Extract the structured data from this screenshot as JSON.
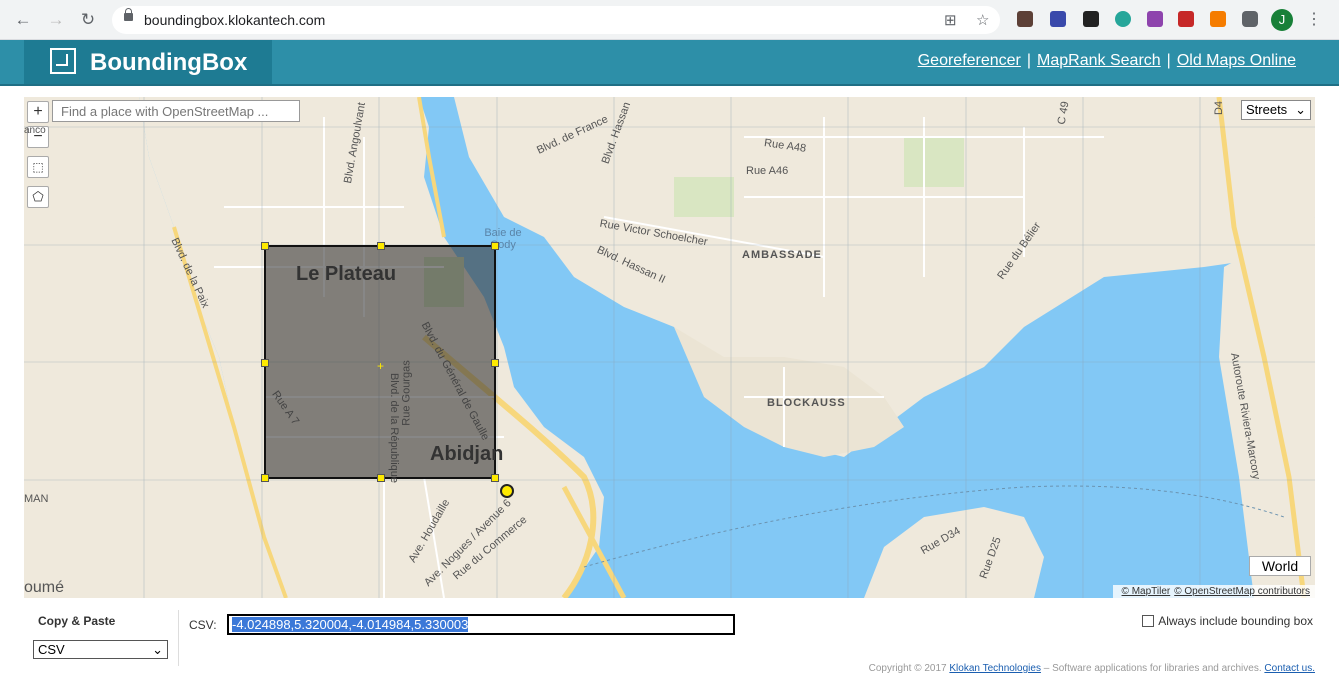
{
  "browser": {
    "url": "boundingbox.klokantech.com",
    "profile_initial": "J"
  },
  "header": {
    "brand": "BoundingBox",
    "links": [
      "Georeferencer",
      "MapRank Search",
      "Old Maps Online"
    ],
    "accent_color": "#2d8fa8"
  },
  "map": {
    "search_placeholder": "Find a place with OpenStreetMap ...",
    "layer_select": "Streets",
    "world_button": "World",
    "attribution": [
      "© MapTiler",
      "© OpenStreetMap contributors"
    ],
    "labels": {
      "district_1": "Le Plateau",
      "district_2": "Abidjan",
      "area_1": "AMBASSADE",
      "area_2": "BLOCKAUSS",
      "water": "Baie de Cody",
      "edge_left": "oumé",
      "edge_left_2": "MAN",
      "edge_left_3": "anco"
    },
    "streets": [
      "Blvd. Angoulvant",
      "Blvd. de France",
      "Blvd. Hassan",
      "Rue A48",
      "Rue A46",
      "C 49",
      "Rue Victor Schoelcher",
      "Blvd. Hassan II",
      "Rue du Bélier",
      "Autoroute Riviera-Marcory",
      "Blvd. de la Paix",
      "Blvd. du Général de Gaulle",
      "Rue Gourgas",
      "Blvd. de la République",
      "Rue A 7",
      "Ave. Houdaille",
      "Ave. Nogues / Avenue 6",
      "Rue du Commerce",
      "Rue D34",
      "Rue D25",
      "D4"
    ],
    "water_color": "#82c8f5",
    "land_color": "#efe9dc"
  },
  "panel": {
    "copy_paste_label": "Copy & Paste",
    "format": "CSV",
    "csv_label": "CSV:",
    "csv_value": "-4.024898,5.320004,-4.014984,5.330003",
    "always_include": "Always include bounding box"
  },
  "footer": {
    "prefix": "Copyright © 2017",
    "company": "Klokan Technologies",
    "middle": "– Software applications for libraries and archives.",
    "contact": "Contact us."
  }
}
